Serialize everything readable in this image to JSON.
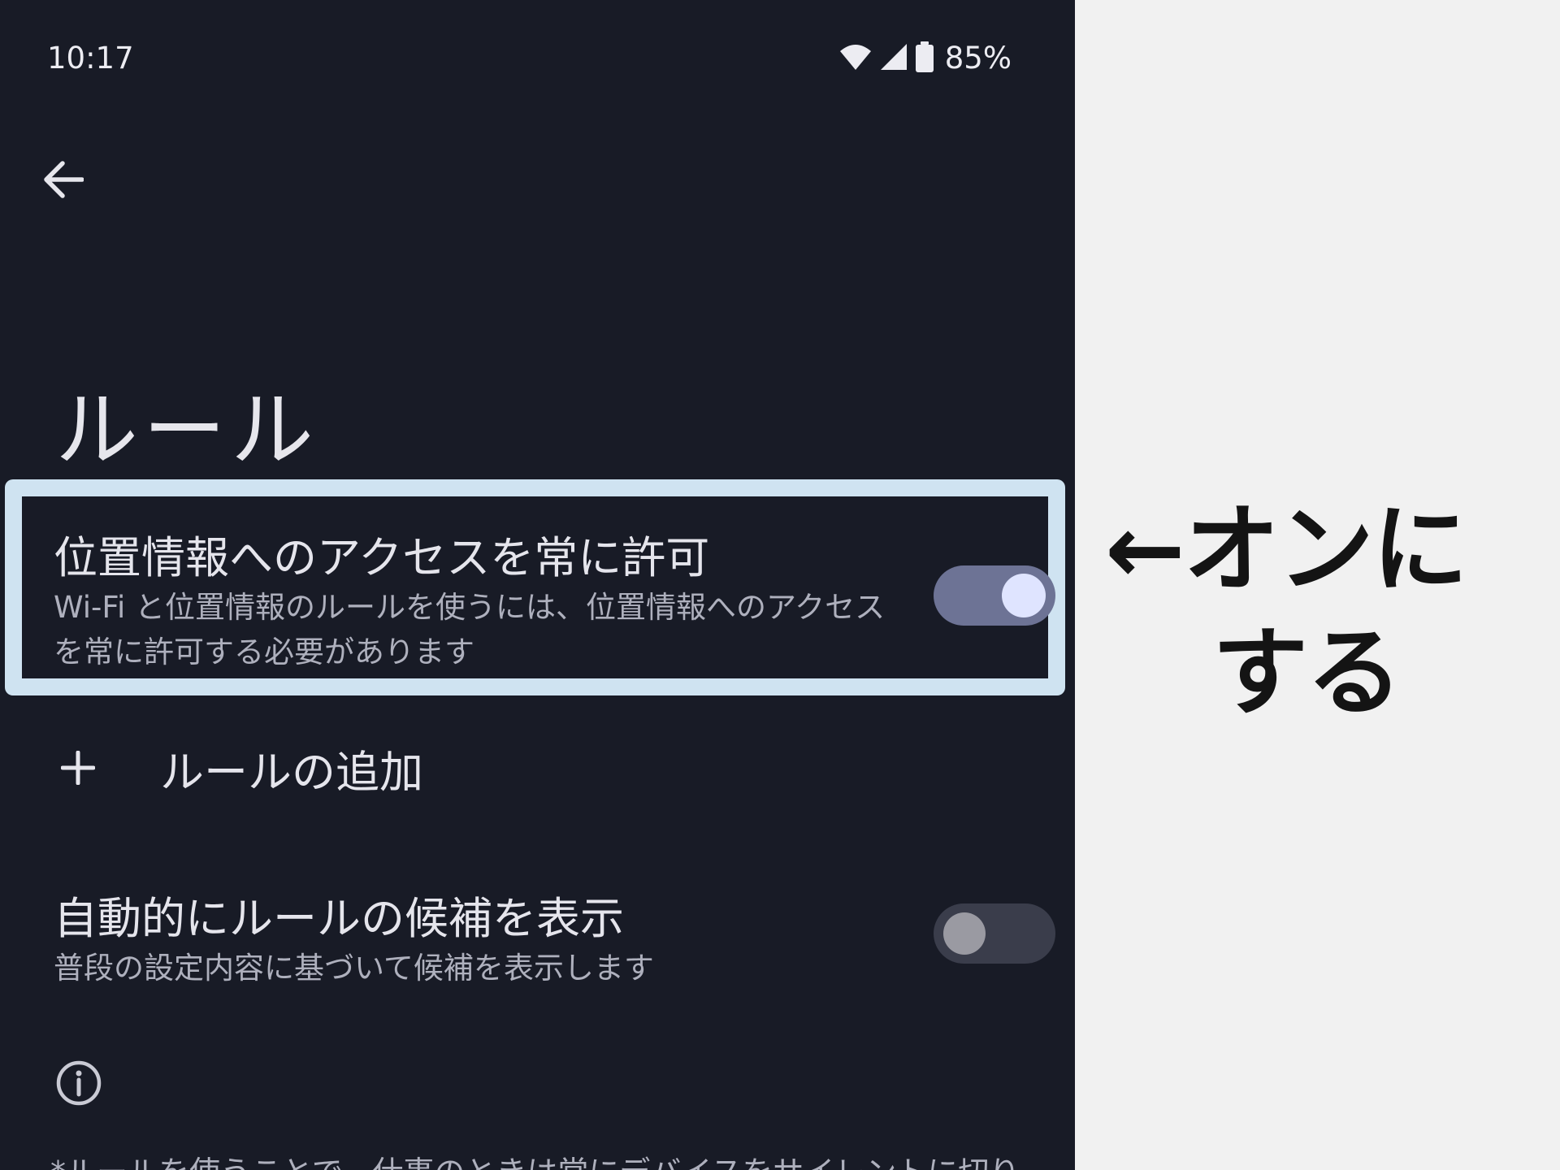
{
  "status_bar": {
    "time": "10:17",
    "battery": "85%",
    "icons": [
      "wifi-icon",
      "cellular-signal-icon",
      "battery-icon"
    ]
  },
  "header": {
    "back_icon": "back-arrow-icon",
    "title": "ルール"
  },
  "settings": {
    "location_access": {
      "title": "位置情報へのアクセスを常に許可",
      "description_line1": "Wi-Fi と位置情報のルールを使うには、位置情報へのアクセス",
      "description_line2": "を常に許可する必要があります",
      "toggle_on": true
    },
    "add_rule": {
      "icon": "plus-icon",
      "label": "ルールの追加"
    },
    "auto_suggest": {
      "title": "自動的にルールの候補を表示",
      "description": "普段の設定内容に基づいて候補を表示します",
      "toggle_on": false
    }
  },
  "info": {
    "icon": "info-icon",
    "footer_text": "*ルールを使うことで、仕事のときは常にデバイスをサイレントに切り"
  },
  "annotation": {
    "line1": "←オンに",
    "line2": "する"
  },
  "colors": {
    "phone_background": "#181b26",
    "highlight_frame": "#cfe3f1",
    "toggle_on_track": "#6d7395",
    "toggle_on_knob": "#dfe4ff",
    "toggle_off_track": "#3a3d4b",
    "toggle_off_knob": "#9a9aa2",
    "annotation_background": "#f1f1f1",
    "annotation_text": "#141414"
  }
}
